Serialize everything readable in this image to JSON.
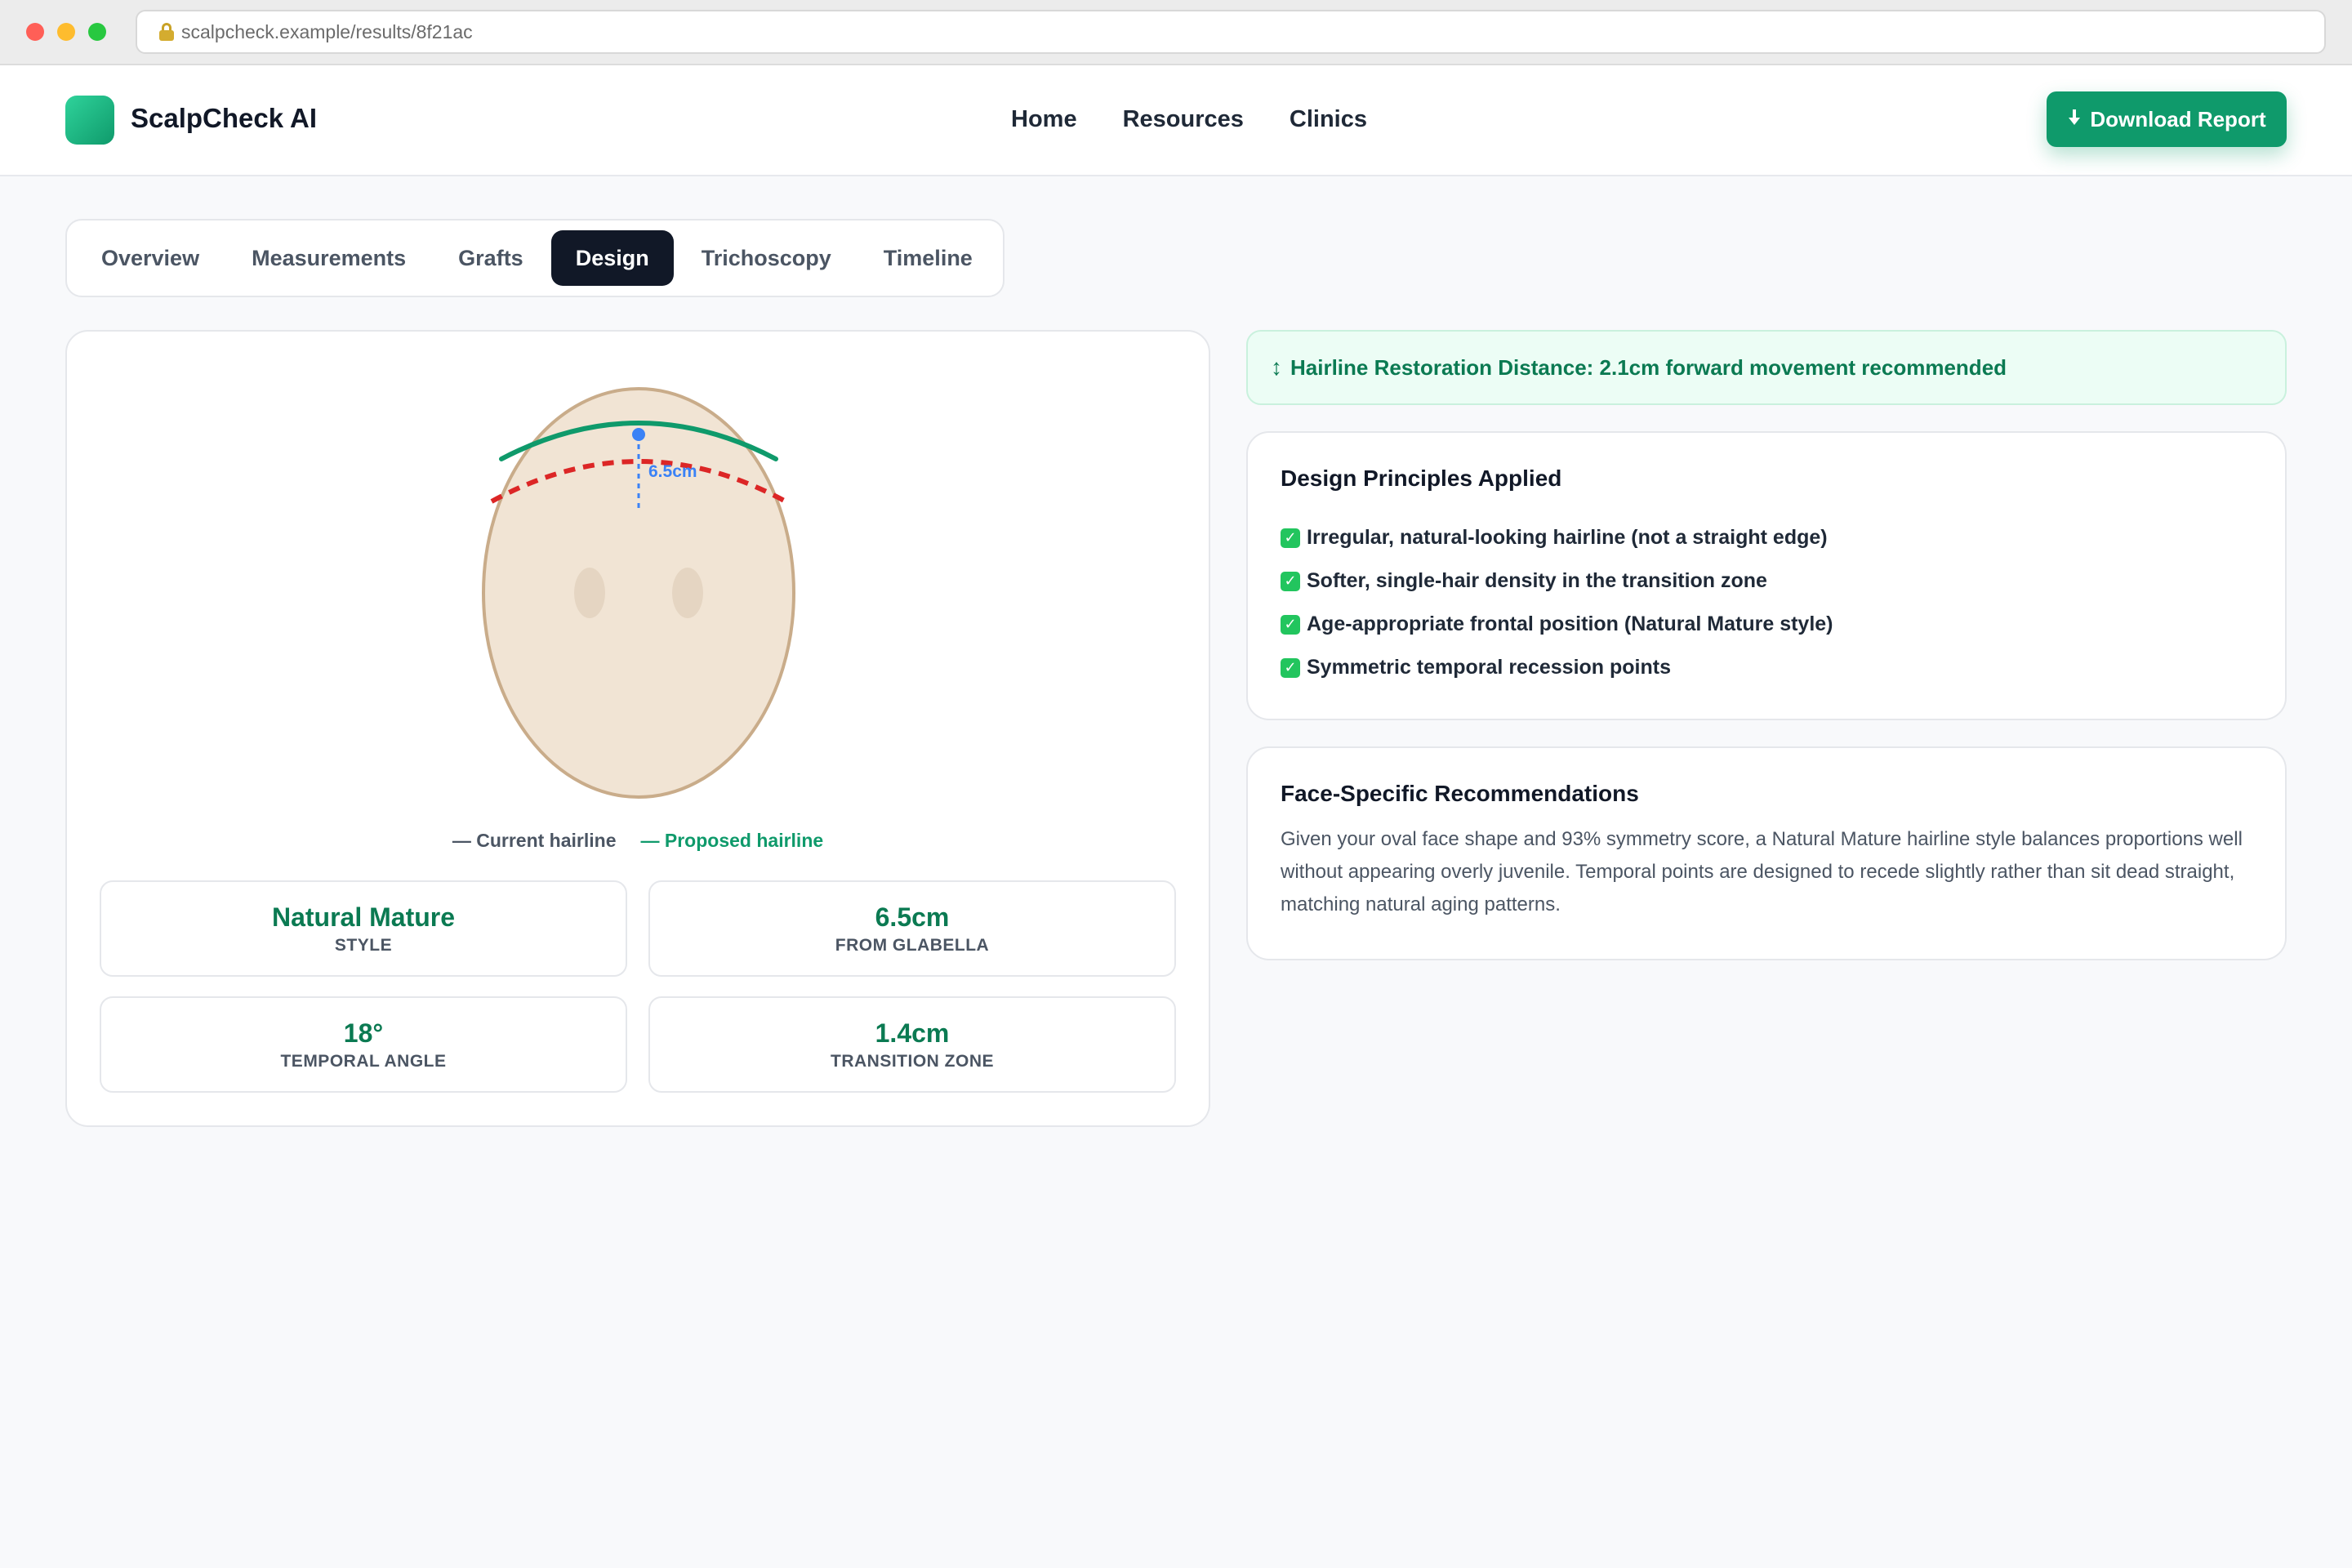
{
  "browser": {
    "url": "scalpcheck.example/results/8f21ac"
  },
  "header": {
    "brand": "ScalpCheck AI",
    "nav": [
      "Home",
      "Resources",
      "Clinics"
    ],
    "download_label": "Download Report"
  },
  "tabs": [
    "Overview",
    "Measurements",
    "Grafts",
    "Design",
    "Trichoscopy",
    "Timeline"
  ],
  "active_tab": "Design",
  "diagram": {
    "measurement_label": "6.5cm",
    "legend_current": "— Current hairline",
    "legend_proposed": "— Proposed hairline",
    "colors": {
      "face_fill": "#f1e4d4",
      "face_stroke": "#c9ac8a",
      "current_hairline": "#dc2626",
      "proposed_hairline": "#0f9a6b",
      "measure": "#3b82f6"
    }
  },
  "stats": [
    {
      "value": "Natural Mature",
      "label": "STYLE"
    },
    {
      "value": "6.5cm",
      "label": "FROM GLABELLA"
    },
    {
      "value": "18°",
      "label": "TEMPORAL ANGLE"
    },
    {
      "value": "1.4cm",
      "label": "TRANSITION ZONE"
    }
  ],
  "banner": {
    "icon": "↕",
    "text": "Hairline Restoration Distance: 2.1cm forward movement recommended"
  },
  "principles": {
    "title": "Design Principles Applied",
    "items": [
      "Irregular, natural-looking hairline (not a straight edge)",
      "Softer, single-hair density in the transition zone",
      "Age-appropriate frontal position (Natural Mature style)",
      "Symmetric temporal recession points"
    ]
  },
  "recommendations": {
    "title": "Face-Specific Recommendations",
    "text": "Given your oval face shape and 93% symmetry score, a Natural Mature hairline style balances proportions well without appearing overly juvenile. Temporal points are designed to recede slightly rather than sit dead straight, matching natural aging patterns."
  }
}
